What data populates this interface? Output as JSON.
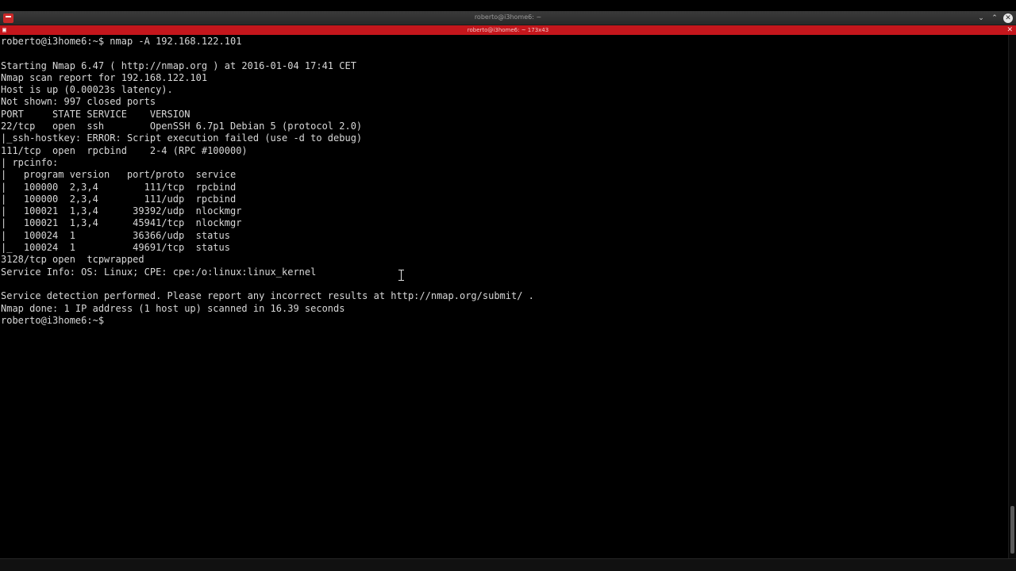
{
  "window": {
    "title": "roberto@i3home6: ~",
    "buttons": {
      "minimize": "⌄",
      "maximize": "⌃",
      "close": "✕"
    }
  },
  "tab": {
    "title": "roberto@i3home6: ~ 173x43",
    "icon": "terminal-icon",
    "close": "✕"
  },
  "colors": {
    "tab_bar": "#c4161c",
    "terminal_bg": "#000000",
    "terminal_fg": "#d8d8d8"
  },
  "terminal": {
    "lines": [
      "roberto@i3home6:~$ nmap -A 192.168.122.101",
      "",
      "Starting Nmap 6.47 ( http://nmap.org ) at 2016-01-04 17:41 CET",
      "Nmap scan report for 192.168.122.101",
      "Host is up (0.00023s latency).",
      "Not shown: 997 closed ports",
      "PORT     STATE SERVICE    VERSION",
      "22/tcp   open  ssh        OpenSSH 6.7p1 Debian 5 (protocol 2.0)",
      "|_ssh-hostkey: ERROR: Script execution failed (use -d to debug)",
      "111/tcp  open  rpcbind    2-4 (RPC #100000)",
      "| rpcinfo:",
      "|   program version   port/proto  service",
      "|   100000  2,3,4        111/tcp  rpcbind",
      "|   100000  2,3,4        111/udp  rpcbind",
      "|   100021  1,3,4      39392/udp  nlockmgr",
      "|   100021  1,3,4      45941/tcp  nlockmgr",
      "|   100024  1          36366/udp  status",
      "|_  100024  1          49691/tcp  status",
      "3128/tcp open  tcpwrapped",
      "Service Info: OS: Linux; CPE: cpe:/o:linux:linux_kernel",
      "",
      "Service detection performed. Please report any incorrect results at http://nmap.org/submit/ .",
      "Nmap done: 1 IP address (1 host up) scanned in 16.39 seconds",
      "roberto@i3home6:~$ "
    ]
  }
}
